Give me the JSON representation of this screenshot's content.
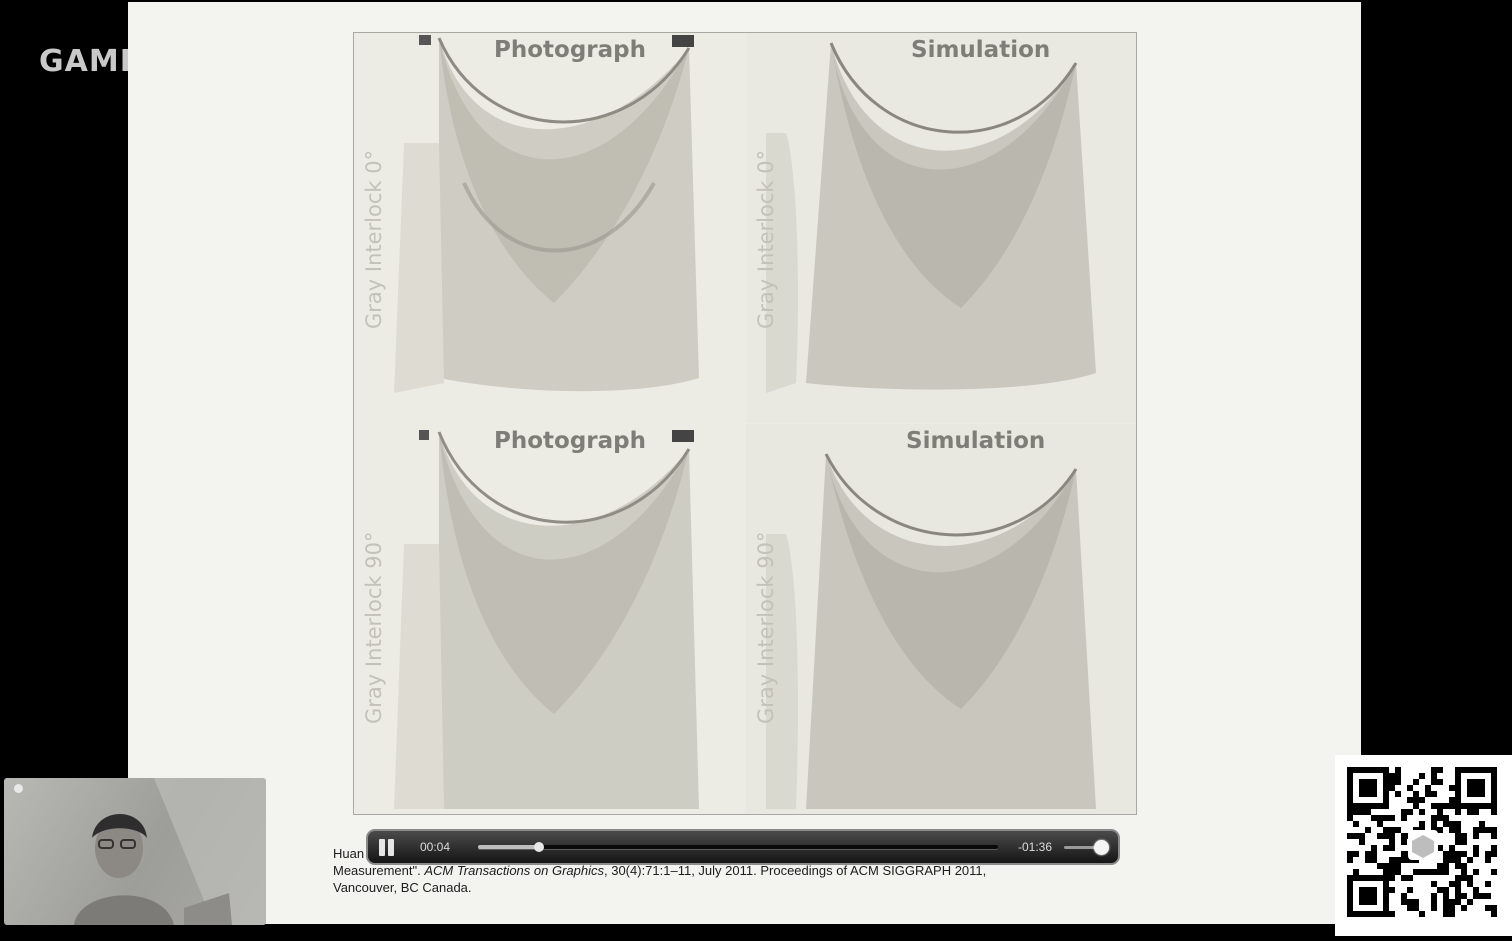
{
  "overlay": {
    "brand_text": "GAME"
  },
  "figure": {
    "panels": [
      {
        "title": "Photograph",
        "side_label": "Gray Interlock 0°"
      },
      {
        "title": "Simulation",
        "side_label": "Gray Interlock 0°"
      },
      {
        "title": "Photograph",
        "side_label": "Gray Interlock 90°"
      },
      {
        "title": "Simulation",
        "side_label": "Gray Interlock 90°"
      }
    ]
  },
  "citation": {
    "line1_start": "Huan",
    "line2_start": "Measurement\". ",
    "journal": "ACM Transactions on Graphics",
    "line2_rest": ", 30(4):71:1–11, July 2011. Proceedings of ACM SIGGRAPH 2011,",
    "line3": "Vancouver, BC Canada."
  },
  "player": {
    "current_time": "00:04",
    "remaining_time": "-01:36",
    "progress_fraction": 0.05,
    "volume_fraction": 1.0
  },
  "colors": {
    "slide_bg": "#f3f3ef",
    "player_bg": "#1e1e1e"
  },
  "icons": {
    "pause": "pause-icon",
    "volume_knob": "volume-knob-icon"
  }
}
